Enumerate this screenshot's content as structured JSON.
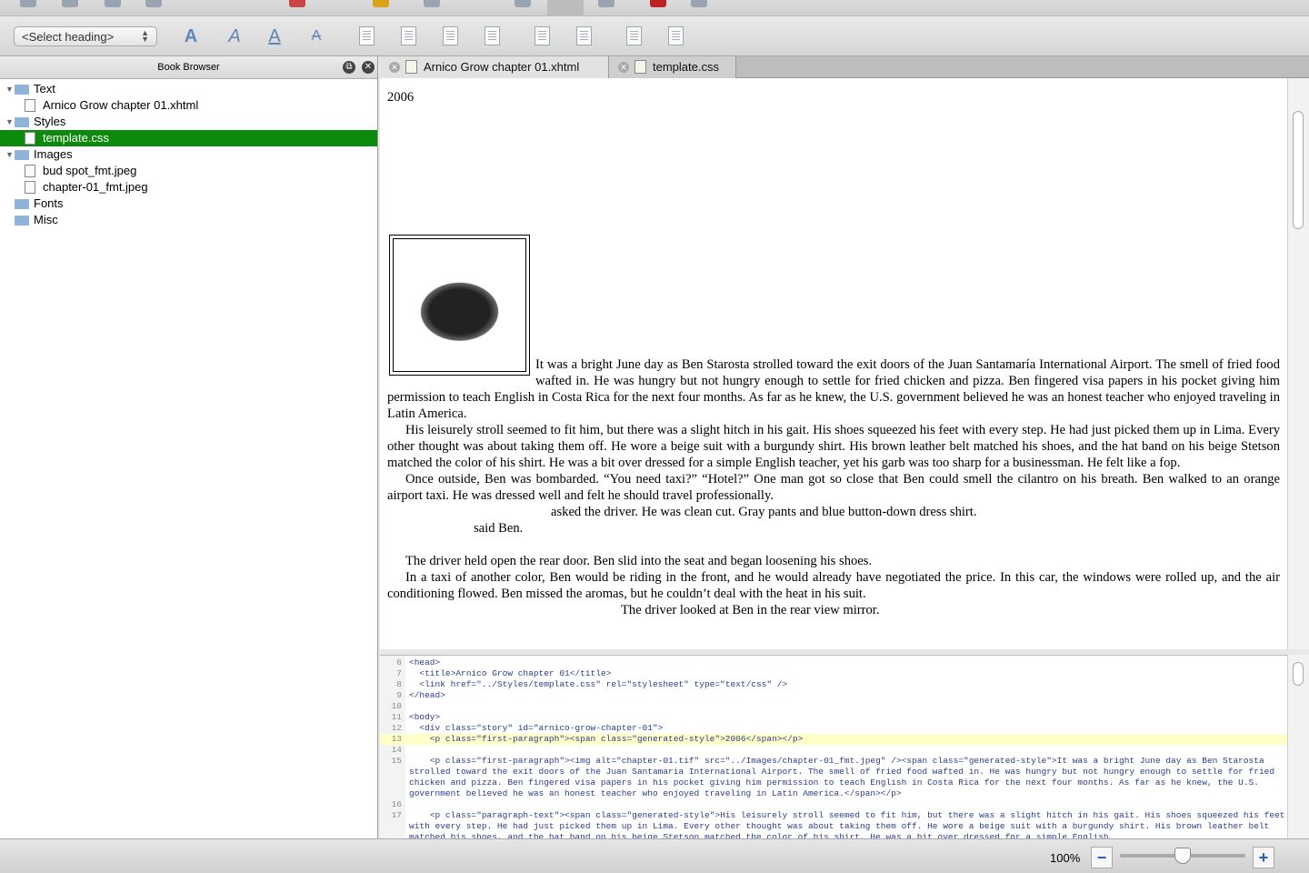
{
  "toolbar": {
    "heading_select": "<Select heading>"
  },
  "sidebar": {
    "title": "Book Browser",
    "items": [
      {
        "label": "Text",
        "type": "folder",
        "open": true
      },
      {
        "label": "Arnico Grow chapter 01.xhtml",
        "type": "file"
      },
      {
        "label": "Styles",
        "type": "folder",
        "open": true
      },
      {
        "label": "template.css",
        "type": "file",
        "selected": true
      },
      {
        "label": "Images",
        "type": "folder",
        "open": true
      },
      {
        "label": "bud spot_fmt.jpeg",
        "type": "file"
      },
      {
        "label": "chapter-01_fmt.jpeg",
        "type": "file"
      },
      {
        "label": "Fonts",
        "type": "folder"
      },
      {
        "label": "Misc",
        "type": "folder"
      }
    ]
  },
  "tabs": [
    {
      "label": "Arnico Grow chapter 01.xhtml"
    },
    {
      "label": "template.css"
    }
  ],
  "doc": {
    "year": "2006",
    "paragraphs": [
      "It was a bright June day as Ben Starosta strolled toward the exit doors of the Juan Santamaría International Airport. The smell of fried food wafted in. He was hungry but not hungry enough to settle for fried chicken and pizza. Ben fingered visa papers in his pocket giving him permission to teach English in Costa Rica for the next four months. As far as he knew, the U.S. government believed he was an honest teacher who enjoyed traveling in Latin America.",
      "His leisurely stroll seemed to fit him, but there was a slight hitch in his gait. His shoes squeezed his feet with every step. He had just picked them up in Lima. Every other thought was about taking them off. He wore a beige suit with a burgundy shirt. His brown leather belt matched his shoes, and the hat band on his beige Stetson matched the color of his shirt. He was a bit over dressed for a simple English teacher, yet his garb was too sharp for a businessman. He felt like a fop.",
      "Once outside, Ben was bombarded. “You need taxi?” “Hotel?” One man got so close that Ben could smell the cilantro on his breath. Ben walked to an orange airport taxi. He was dressed well and felt he should travel professionally.",
      "asked the driver. He was clean cut. Gray pants and blue button-down dress shirt.",
      "said Ben.",
      "The driver held open the rear door. Ben slid into the seat and began loosening his shoes.",
      "In a taxi of another color, Ben would be riding in the front, and he would already have negotiated the price. In this car, the windows were rolled up, and the air conditioning flowed. Ben missed the aromas, but he couldn’t deal with the heat in his suit.",
      "The driver looked at Ben in the rear view mirror."
    ]
  },
  "code": [
    {
      "n": "6",
      "t": "<head>"
    },
    {
      "n": "7",
      "t": "  <title>Arnico Grow chapter 01</title>"
    },
    {
      "n": "8",
      "t": "  <link href=\"../Styles/template.css\" rel=\"stylesheet\" type=\"text/css\" />"
    },
    {
      "n": "9",
      "t": "</head>"
    },
    {
      "n": "10",
      "t": ""
    },
    {
      "n": "11",
      "t": "<body>"
    },
    {
      "n": "12",
      "t": "  <div class=\"story\" id=\"arnico-grow-chapter-01\">"
    },
    {
      "n": "13",
      "t": "    <p class=\"first-paragraph\"><span class=\"generated-style\">2006</span></p>"
    },
    {
      "n": "14",
      "t": ""
    },
    {
      "n": "15",
      "t": "    <p class=\"first-paragraph\"><img alt=\"chapter-01.tif\" src=\"../Images/chapter-01_fmt.jpeg\" /><span class=\"generated-style\">It was a bright June day as Ben Starosta strolled toward the exit doors of the Juan Santamaria International Airport. The smell of fried food wafted in. He was hungry but not hungry enough to settle for fried chicken and pizza. Ben fingered visa papers in his pocket giving him permission to teach English in Costa Rica for the next four months. As far as he knew, the U.S. government believed he was an honest teacher who enjoyed traveling in Latin America.</span></p>"
    },
    {
      "n": "16",
      "t": ""
    },
    {
      "n": "17",
      "t": "    <p class=\"paragraph-text\"><span class=\"generated-style\">His leisurely stroll seemed to fit him, but there was a slight hitch in his gait. His shoes squeezed his feet with every step. He had just picked them up in Lima. Every other thought was about taking them off. He wore a beige suit with a burgundy shirt. His brown leather belt matched his shoes, and the hat band on his beige Stetson matched the color of his shirt. He was a bit over dressed for a simple English"
    }
  ],
  "status": {
    "zoom": "100%",
    "zoom_minus": "−",
    "zoom_plus": "+",
    "zoom_level_percent": 100
  }
}
